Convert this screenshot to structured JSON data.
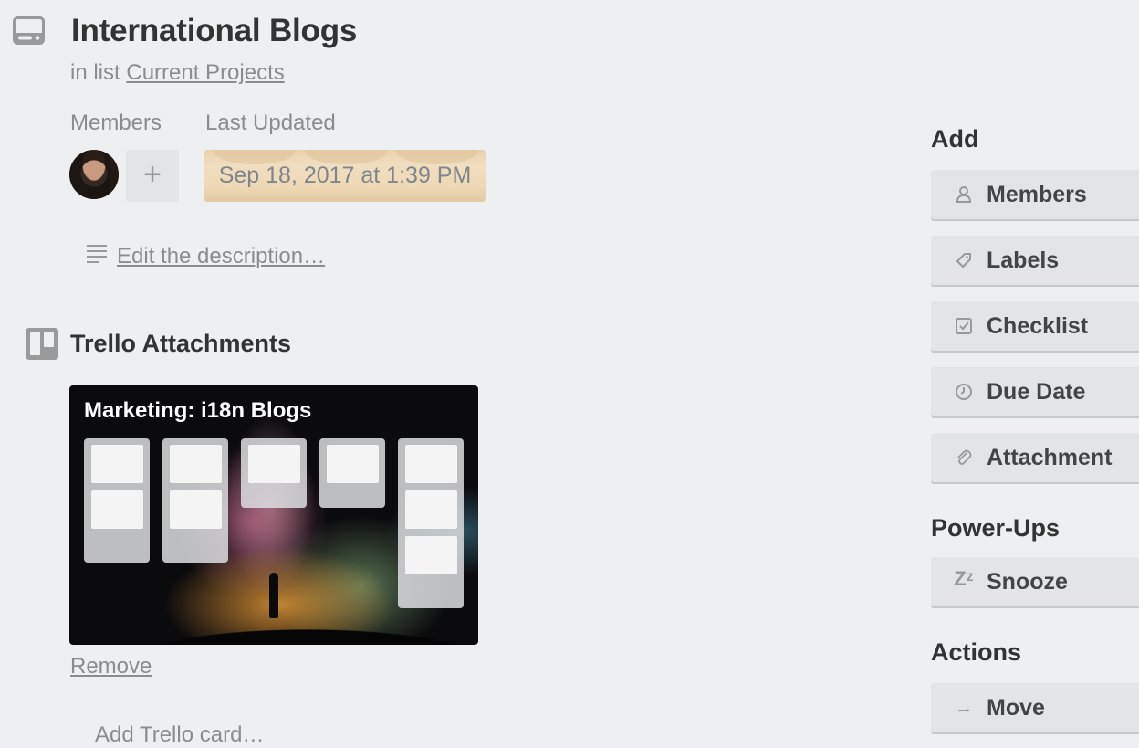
{
  "card": {
    "title": "International Blogs",
    "in_list_prefix": "in list",
    "list_name": "Current Projects",
    "card_icon": "card-icon"
  },
  "members": {
    "label": "Members",
    "add_button_label": "+",
    "avatar_icon": "member-avatar"
  },
  "last_updated": {
    "label": "Last Updated",
    "value": "Sep 18, 2017 at 1:39 PM"
  },
  "description": {
    "icon": "description-icon",
    "link": "Edit the description…"
  },
  "trello_attachments": {
    "icon": "board-icon",
    "title": "Trello Attachments",
    "board": {
      "name": "Marketing: i18n Blogs",
      "lists": [
        {
          "cards": 2
        },
        {
          "cards": 2
        },
        {
          "cards": 1
        },
        {
          "cards": 1
        },
        {
          "cards": 3
        }
      ]
    },
    "remove_link": "Remove",
    "add_link": "Add Trello card…"
  },
  "sidebar": {
    "add_heading": "Add",
    "add_buttons": [
      {
        "icon": "person-icon",
        "glyph": "👤",
        "label": "Members"
      },
      {
        "icon": "tag-icon",
        "glyph": "⌀",
        "label": "Labels"
      },
      {
        "icon": "checkbox-icon",
        "glyph": "☑",
        "label": "Checklist"
      },
      {
        "icon": "clock-icon",
        "glyph": "◷",
        "label": "Due Date"
      },
      {
        "icon": "paperclip-icon",
        "glyph": "⌇",
        "label": "Attachment"
      }
    ],
    "powerups_heading": "Power-Ups",
    "powerup_buttons": [
      {
        "icon": "snooze-icon",
        "glyph": "Zᶻ",
        "label": "Snooze"
      }
    ],
    "actions_heading": "Actions",
    "action_buttons": [
      {
        "icon": "arrow-right-icon",
        "glyph": "→",
        "label": "Move"
      }
    ]
  }
}
